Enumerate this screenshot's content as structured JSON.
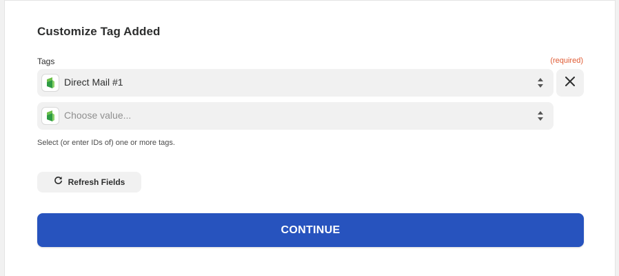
{
  "form": {
    "title": "Customize Tag Added",
    "tags_field": {
      "label": "Tags",
      "required_text": "(required)",
      "values": [
        {
          "text": "Direct Mail #1",
          "icon": "app-logo-icon"
        }
      ],
      "empty_placeholder": "Choose value...",
      "help_text": "Select (or enter IDs of) one or more tags."
    },
    "refresh_button": {
      "label": "Refresh Fields",
      "icon": "refresh-icon"
    },
    "continue_button": {
      "label": "CONTINUE"
    }
  },
  "colors": {
    "accent": "#2753be",
    "required": "#e05a32",
    "field_bg": "#f1f1f1",
    "logo_green": "#4caf50"
  }
}
